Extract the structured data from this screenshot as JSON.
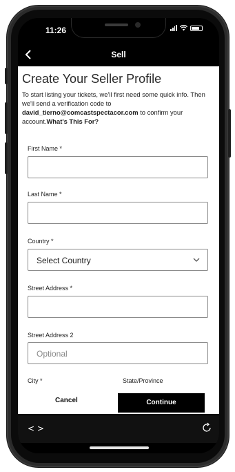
{
  "status_bar": {
    "time": "11:26"
  },
  "nav": {
    "title": "Sell"
  },
  "page": {
    "heading": "Create Your Seller Profile",
    "intro_part1": "To start listing your tickets, we'll first need some quick info. Then we'll send a verification code to ",
    "email": "david_tierno@comcastspectacor.com",
    "intro_part2": " to confirm your account.",
    "whats_this": "What's This For?"
  },
  "form": {
    "first_name_label": "First Name *",
    "last_name_label": "Last Name *",
    "country_label": "Country *",
    "country_value": "Select Country",
    "street_address_label": "Street Address *",
    "street_address2_label": "Street Address 2",
    "street_address2_placeholder": "Optional",
    "city_label": "City *",
    "state_label": "State/Province"
  },
  "actions": {
    "cancel": "Cancel",
    "continue": "Continue"
  },
  "browser": {
    "nav_glyphs": "< >"
  }
}
